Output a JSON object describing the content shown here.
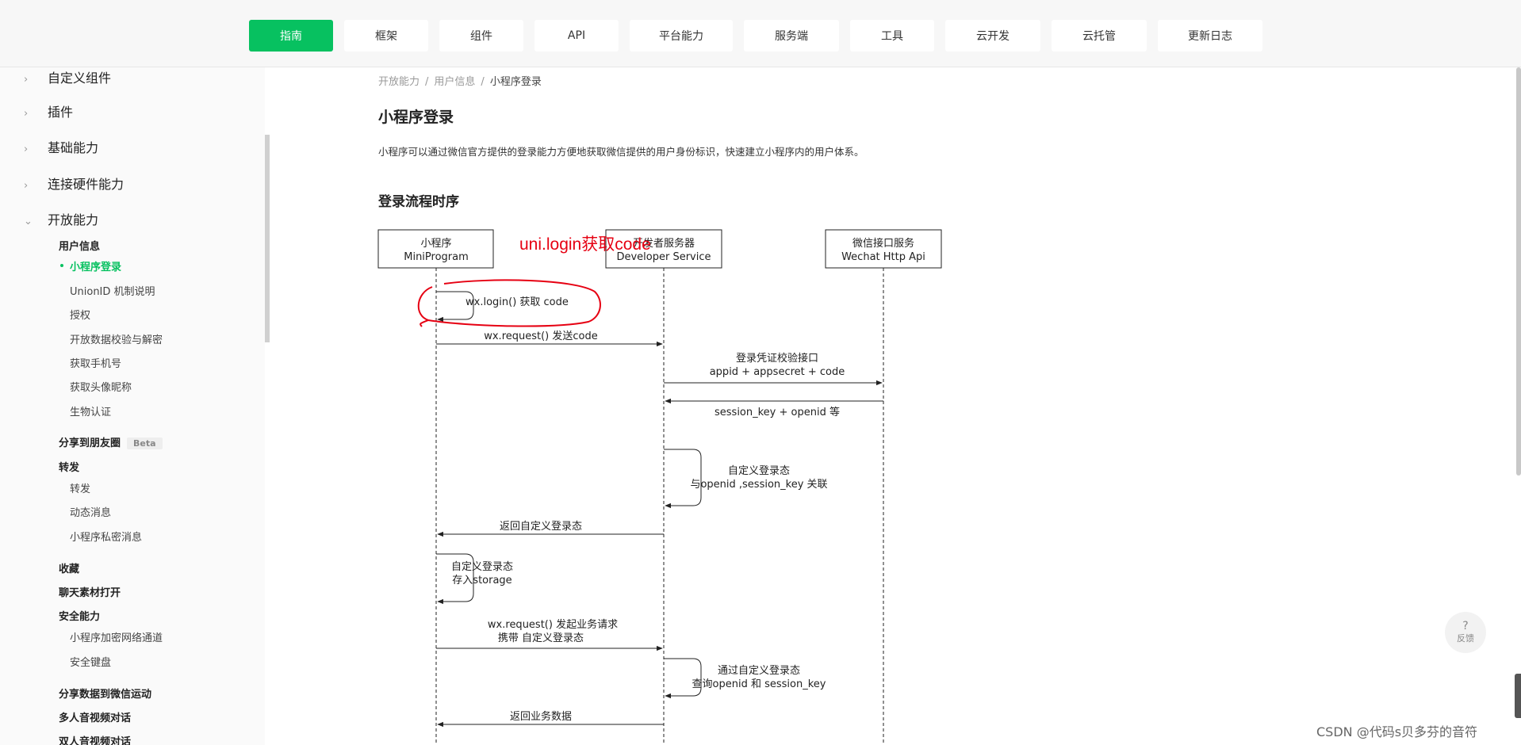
{
  "nav": {
    "tabs": [
      {
        "label": "指南",
        "active": true
      },
      {
        "label": "框架"
      },
      {
        "label": "组件"
      },
      {
        "label": "API"
      },
      {
        "label": "平台能力"
      },
      {
        "label": "服务端"
      },
      {
        "label": "工具"
      },
      {
        "label": "云开发"
      },
      {
        "label": "云托管"
      },
      {
        "label": "更新日志"
      }
    ]
  },
  "sidebar": {
    "top_items": [
      "自定义组件",
      "插件",
      "基础能力",
      "连接硬件能力",
      "开放能力"
    ],
    "groups": {
      "user_info": "用户信息",
      "share_moments": "分享到朋友圈",
      "share_moments_badge": "Beta",
      "forward": "转发",
      "favorites": "收藏",
      "chat_material": "聊天素材打开",
      "security": "安全能力",
      "werun": "分享数据到微信运动",
      "multi_av": "多人音视频对话",
      "dual_av": "双人音视频对话"
    },
    "items": {
      "login": "小程序登录",
      "unionid": "UnionID 机制说明",
      "auth": "授权",
      "open_data": "开放数据校验与解密",
      "phone": "获取手机号",
      "avatar": "获取头像昵称",
      "bio": "生物认证",
      "forward": "转发",
      "dynamic_msg": "动态消息",
      "private_msg": "小程序私密消息",
      "encrypted_net": "小程序加密网络通道",
      "secure_keyboard": "安全键盘"
    }
  },
  "breadcrumb": {
    "level1": "开放能力",
    "level2": "用户信息",
    "current": "小程序登录",
    "sep": "/"
  },
  "page": {
    "title": "小程序登录",
    "intro": "小程序可以通过微信官方提供的登录能力方便地获取微信提供的用户身份标识，快速建立小程序内的用户体系。",
    "section_title": "登录流程时序"
  },
  "diagram": {
    "actors": {
      "mp_cn": "小程序",
      "mp_en": "MiniProgram",
      "dev_cn": "开发者服务器",
      "dev_en": "Developer Service",
      "wx_cn": "微信接口服务",
      "wx_en": "Wechat Http Api"
    },
    "messages": {
      "m1": "wx.login() 获取 code",
      "m2": "wx.request() 发送code",
      "m3a": "登录凭证校验接口",
      "m3b": "appid + appsecret + code",
      "m4": "session_key + openid 等",
      "m5a": "自定义登录态",
      "m5b": "与openid ,session_key 关联",
      "m6": "返回自定义登录态",
      "m7a": "自定义登录态",
      "m7b": "存入storage",
      "m8a": "wx.request() 发起业务请求",
      "m8b": "携带 自定义登录态",
      "m9a": "通过自定义登录态",
      "m9b": "查询openid 和 session_key",
      "m10": "返回业务数据"
    },
    "annotation": "uni.login获取code",
    "annotation_color": "#e60012"
  },
  "widgets": {
    "feedback_icon": "?",
    "feedback_label": "反馈"
  },
  "watermark": "CSDN @代码s贝多芬的音符",
  "colors": {
    "brand": "#07c160"
  }
}
